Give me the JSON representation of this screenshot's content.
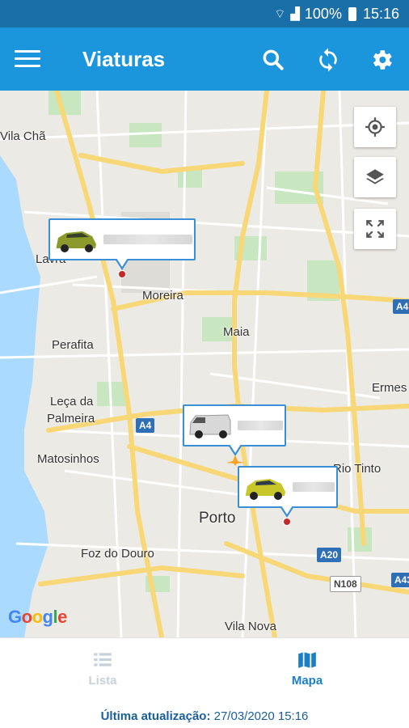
{
  "status_bar": {
    "battery": "100%",
    "time": "15:16"
  },
  "app_bar": {
    "title": "Viaturas"
  },
  "map": {
    "places": [
      "Vila Chã",
      "Lavra",
      "Moreira",
      "Maia",
      "Perafita",
      "Leça da",
      "Palmeira",
      "Matosinhos",
      "Porto",
      "Foz do Douro",
      "Rio Tinto",
      "Ermes",
      "Vila Nova"
    ],
    "road_shields": [
      "A4",
      "A4",
      "A20",
      "N108",
      "A43"
    ],
    "google": [
      "G",
      "o",
      "o",
      "g",
      "l",
      "e"
    ]
  },
  "bottom_nav": {
    "tabs": [
      {
        "label": "Lista",
        "active": false
      },
      {
        "label": "Mapa",
        "active": true
      }
    ],
    "last_update_label": "Última atualização:",
    "last_update_value": "27/03/2020 15:16"
  },
  "colors": {
    "app_bar": "#1b96dd",
    "status_bar": "#1a6fa8",
    "accent": "#1b7fc4"
  }
}
